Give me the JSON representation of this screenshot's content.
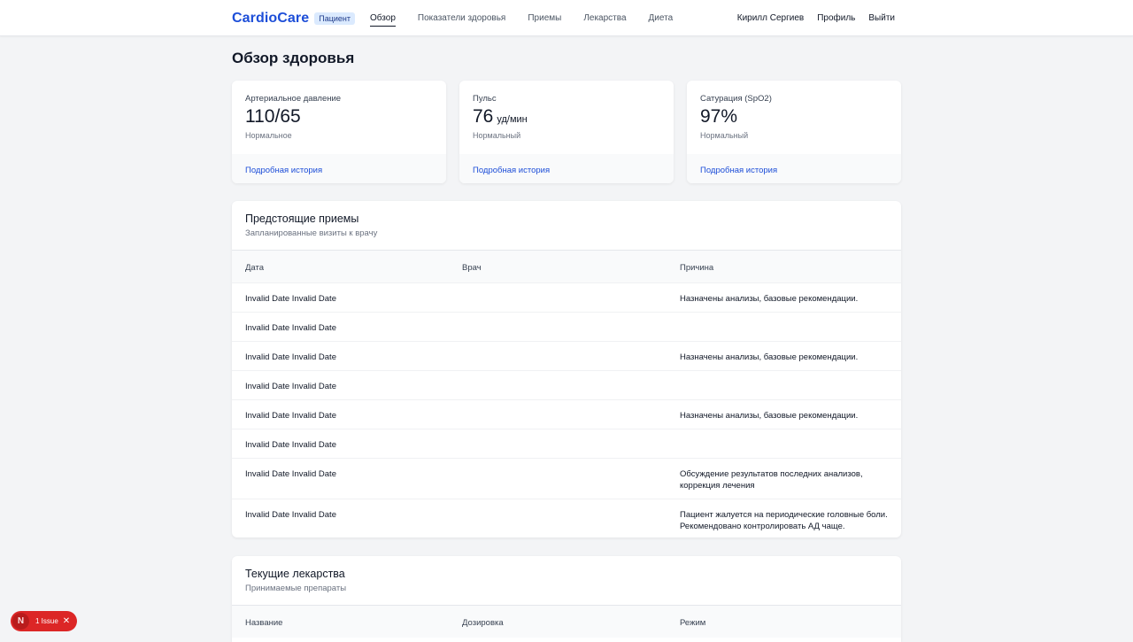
{
  "nav": {
    "logo": "CardioCare",
    "badge": "Пациент",
    "links": [
      "Обзор",
      "Показатели здоровья",
      "Приемы",
      "Лекарства",
      "Диета"
    ],
    "user": "Кирилл Сергиев",
    "profile": "Профиль",
    "logout": "Выйти"
  },
  "page_title": "Обзор здоровья",
  "stats": [
    {
      "label": "Артериальное давление",
      "value": "110/65",
      "unit": "",
      "status": "Нормальное",
      "link": "Подробная история"
    },
    {
      "label": "Пульс",
      "value": "76",
      "unit": "уд/мин",
      "status": "Нормальный",
      "link": "Подробная история"
    },
    {
      "label": "Сатурация (SpO2)",
      "value": "97%",
      "unit": "",
      "status": "Нормальный",
      "link": "Подробная история"
    }
  ],
  "appointments": {
    "title": "Предстоящие приемы",
    "subtitle": "Запланированные визиты к врачу",
    "columns": [
      "Дата",
      "Врач",
      "Причина"
    ],
    "rows": [
      {
        "date": "Invalid Date Invalid Date",
        "doctor": "",
        "reason": "Назначены анализы, базовые рекомендации."
      },
      {
        "date": "Invalid Date Invalid Date",
        "doctor": "",
        "reason": ""
      },
      {
        "date": "Invalid Date Invalid Date",
        "doctor": "",
        "reason": "Назначены анализы, базовые рекомендации."
      },
      {
        "date": "Invalid Date Invalid Date",
        "doctor": "",
        "reason": ""
      },
      {
        "date": "Invalid Date Invalid Date",
        "doctor": "",
        "reason": "Назначены анализы, базовые рекомендации."
      },
      {
        "date": "Invalid Date Invalid Date",
        "doctor": "",
        "reason": ""
      },
      {
        "date": "Invalid Date Invalid Date",
        "doctor": "",
        "reason": "Обсуждение результатов последних анализов, коррекция лечения"
      },
      {
        "date": "Invalid Date Invalid Date",
        "doctor": "",
        "reason": "Пациент жалуется на периодические головные боли. Рекомендовано контролировать АД чаще."
      }
    ]
  },
  "medications": {
    "title": "Текущие лекарства",
    "subtitle": "Принимаемые препараты",
    "columns": [
      "Название",
      "Дозировка",
      "Режим"
    ]
  },
  "issue_badge": {
    "logo": "N",
    "text": "1 Issue",
    "close": "✕"
  },
  "colors": {
    "brand": "#1d4ed8",
    "background": "#f3f4f6",
    "issue": "#dc2626"
  }
}
